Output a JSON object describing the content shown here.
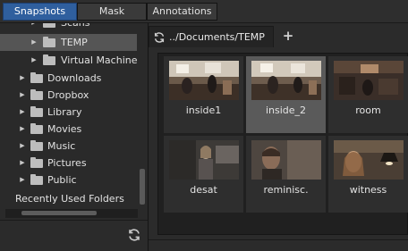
{
  "tabs": [
    {
      "label": "Snapshots",
      "active": true
    },
    {
      "label": "Mask",
      "active": false
    },
    {
      "label": "Annotations",
      "active": false
    }
  ],
  "tree": {
    "items": [
      {
        "label": "Scans",
        "indent": 1,
        "arrow": "right"
      },
      {
        "label": "TEMP",
        "indent": 1,
        "arrow": "right",
        "selected": true
      },
      {
        "label": "Virtual Machines",
        "indent": 1,
        "arrow": "right"
      },
      {
        "label": "Downloads",
        "indent": 0,
        "arrow": "right"
      },
      {
        "label": "Dropbox",
        "indent": 0,
        "arrow": "right"
      },
      {
        "label": "Library",
        "indent": 0,
        "arrow": "right"
      },
      {
        "label": "Movies",
        "indent": 0,
        "arrow": "right"
      },
      {
        "label": "Music",
        "indent": 0,
        "arrow": "right"
      },
      {
        "label": "Pictures",
        "indent": 0,
        "arrow": "right"
      },
      {
        "label": "Public",
        "indent": 0,
        "arrow": "right"
      }
    ],
    "recent_label": "Recently Used Folders"
  },
  "browser": {
    "path": "../Documents/TEMP",
    "add_tab_label": "+",
    "thumbnails": [
      {
        "label": "inside1",
        "selected": false
      },
      {
        "label": "inside_2",
        "selected": true
      },
      {
        "label": "room",
        "selected": false
      },
      {
        "label": "desat",
        "selected": false
      },
      {
        "label": "reminisc.",
        "selected": false
      },
      {
        "label": "witness",
        "selected": false
      }
    ]
  },
  "icons": {
    "folder": "folder-icon",
    "refresh": "refresh-icon",
    "add": "plus-icon",
    "expand": "chevron-right-icon"
  },
  "colors": {
    "active_tab": "#2f5f9e",
    "selection": "#555555"
  }
}
